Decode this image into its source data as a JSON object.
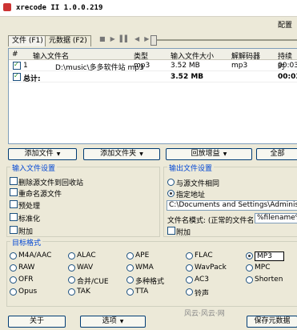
{
  "window": {
    "title": "xrecode II 1.0.0.219",
    "config": "配置"
  },
  "tabs": [
    "文件 (F1)",
    "元数据 (F2)"
  ],
  "grid": {
    "headers": [
      "#",
      "输入文件名",
      "类型",
      "输入文件大小",
      "解解码器",
      "持续时"
    ],
    "rows": [
      {
        "num": "1",
        "name": "D:\\music\\多多软件站 mp3",
        "type": "mp3",
        "size": "3.52 MB",
        "codec": "mp3",
        "dur": "00:03"
      },
      {
        "num": "总计:",
        "name": "",
        "type": "",
        "size": "3.52 MB",
        "codec": "",
        "dur": "00:03"
      }
    ]
  },
  "buttons": {
    "add_file": "添加文件",
    "add_folder": "添加文件夹",
    "replaygain": "回放增益",
    "all": "全部"
  },
  "input_settings": {
    "title": "输入文件设置",
    "items": [
      "删除源文件到回收站",
      "重命名源文件",
      "预处理",
      "标准化",
      "附加"
    ]
  },
  "output_settings": {
    "title": "输出文件设置",
    "same": "与源文件相同",
    "specified": "指定地址",
    "path": "C:\\Documents and Settings\\Administrator\\",
    "mode_label": "文件名模式: (正常的文件名)",
    "mode_value": "%filename%",
    "append": "附加"
  },
  "target": {
    "title": "目标格式",
    "formats": [
      [
        "M4A/AAC",
        "ALAC",
        "APE",
        "FLAC",
        "MP3"
      ],
      [
        "RAW",
        "WAV",
        "WMA",
        "WavPack",
        "MPC"
      ],
      [
        "OFR",
        "合并/CUE",
        "多种格式",
        "AC3",
        "Shorten"
      ],
      [
        "Opus",
        "TAK",
        "TTA",
        "铃声",
        ""
      ]
    ]
  },
  "footer": {
    "about": "关于",
    "options": "选项",
    "watermark": "风云·风云·网",
    "save_meta": "保存元数据"
  }
}
